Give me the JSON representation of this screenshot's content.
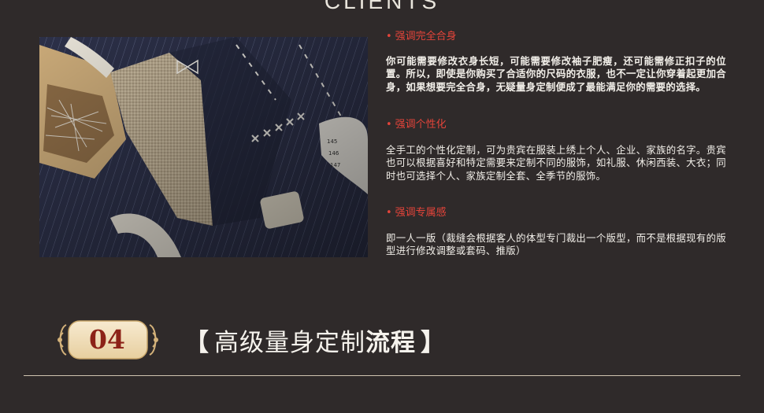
{
  "header": {
    "title": "CLIENTS"
  },
  "photo": {
    "alt": "tailored suit with tape measure"
  },
  "sections": [
    {
      "bullet": "•",
      "heading": "强调完全合身",
      "text": "你可能需要修改衣身长短，可能需要修改袖子肥瘦，还可能需修正扣子的位置。所以，即使是你购买了合适你的尺码的衣服，也不一定让你穿着起更加合身，如果想要完全合身，无疑量身定制便成了最能满足你的需要的选择。"
    },
    {
      "bullet": "•",
      "heading": "强调个性化",
      "text": "全手工的个性化定制，可为贵宾在服装上绣上个人、企业、家族的名字。贵宾也可以根据喜好和特定需要来定制不同的服饰，如礼服、休闲西装、大衣；同时也可选择个人、家族定制全套、全季节的服饰。"
    },
    {
      "bullet": "•",
      "heading": "强调专属感",
      "text": "即一人一版（裁缝会根据客人的体型专门裁出一个版型，而不是根据现有的版型进行修改调整或套码、推版）"
    }
  ],
  "step": {
    "number": "04",
    "bracket_open": "【",
    "title_light": "高级量身定制",
    "title_bold": "流程",
    "bracket_close": "】"
  },
  "colors": {
    "background": "#2f2a2a",
    "heading_red": "#e4443a",
    "badge_number": "#8c2218",
    "badge_fill": "#f4e4c4"
  }
}
